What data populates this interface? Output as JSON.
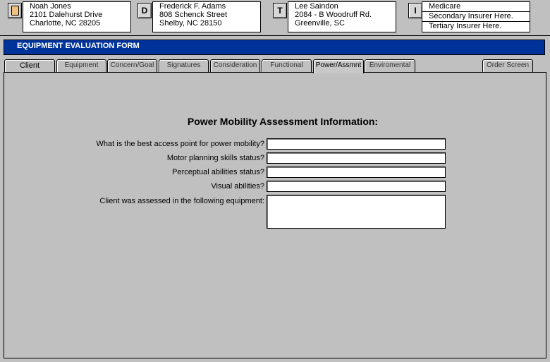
{
  "patient": {
    "name": "Noah Jones",
    "address": "2101 Dalehurst Drive",
    "city": "Charlotte, NC 28205"
  },
  "doctor": {
    "button": "D",
    "name": "Frederick F. Adams",
    "address": "808 Schenck Street",
    "city": "Shelby, NC 28150"
  },
  "therapist": {
    "button": "T",
    "name": "Lee Saindon",
    "address": "2084  - B Woodruff Rd.",
    "city": "Greenville, SC"
  },
  "insurance": {
    "button": "I",
    "primary": "Medicare",
    "secondary": "Secondary  Insurer Here.",
    "tertiary": "Tertiary Insurer Here."
  },
  "form": {
    "banner": "EQUIPMENT EVALUATION FORM",
    "title": "Power Mobility Assessment Information:"
  },
  "tabs": [
    "Client",
    "Equipment",
    "Concern/Goal",
    "Signatures",
    "Consideration",
    "Functional",
    "Power/Assmnt",
    "Enviromental",
    "Order Screen"
  ],
  "active_tab": "Power/Assmnt",
  "fields": {
    "access_point": {
      "label": "What is the best access point for power mobility?",
      "value": ""
    },
    "motor_planning": {
      "label": "Motor planning skills status?",
      "value": ""
    },
    "perceptual": {
      "label": "Perceptual abilities status?",
      "value": ""
    },
    "visual": {
      "label": "Visual abilities?",
      "value": ""
    },
    "equipment_assessed": {
      "label": "Client was assessed in the following equipment:",
      "value": ""
    }
  }
}
